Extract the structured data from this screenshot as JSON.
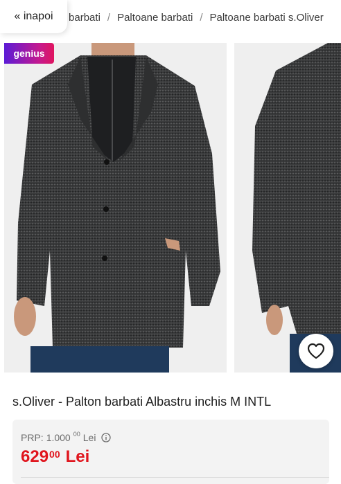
{
  "nav": {
    "back_label": "« inapoi",
    "breadcrumb": [
      "Imbracaminte barbati",
      "Paltoane barbati",
      "Paltoane barbati s.Oliver"
    ],
    "separator": "/"
  },
  "gallery": {
    "badge": "genius",
    "favorite_icon": "heart-icon"
  },
  "product": {
    "title": "s.Oliver - Palton barbati Albastru inchis M INTL"
  },
  "price": {
    "prp_label": "PRP:",
    "prp_value": "1.000",
    "prp_decimals": "00",
    "prp_currency": "Lei",
    "main_value": "629",
    "main_decimals": "00",
    "main_currency": "Lei"
  },
  "colors": {
    "price_red": "#e0151d",
    "genius_start": "#5b1bd6",
    "genius_end": "#e0155f"
  }
}
